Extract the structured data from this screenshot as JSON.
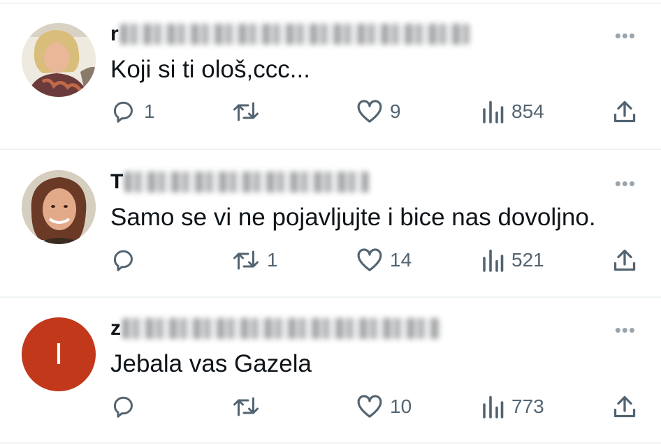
{
  "tweets": [
    {
      "username_first": "r",
      "text": "Koji si ti ološ,ccc...",
      "reply_count": "1",
      "retweet_count": "",
      "like_count": "9",
      "view_count": "854",
      "avatar": {
        "type": "photo",
        "colors": [
          "#caa76a",
          "#7a4a3a"
        ]
      }
    },
    {
      "username_first": "T",
      "text": "Samo se vi ne pojavljujte i bice nas dovoljno.",
      "reply_count": "",
      "retweet_count": "1",
      "like_count": "14",
      "view_count": "521",
      "avatar": {
        "type": "photo",
        "colors": [
          "#b9a98e",
          "#5a3a2a"
        ]
      }
    },
    {
      "username_first": "z",
      "text": "Jebala vas Gazela",
      "reply_count": "",
      "retweet_count": "",
      "like_count": "10",
      "view_count": "773",
      "avatar": {
        "type": "initial",
        "letter": "I",
        "color": "#c1381b"
      }
    }
  ],
  "more_label": "•••",
  "icons": [
    "reply-icon",
    "retweet-icon",
    "like-icon",
    "views-icon",
    "share-icon"
  ],
  "colors": {
    "text": "#0f1419",
    "secondary": "#536471",
    "divider": "#eff3f4"
  }
}
